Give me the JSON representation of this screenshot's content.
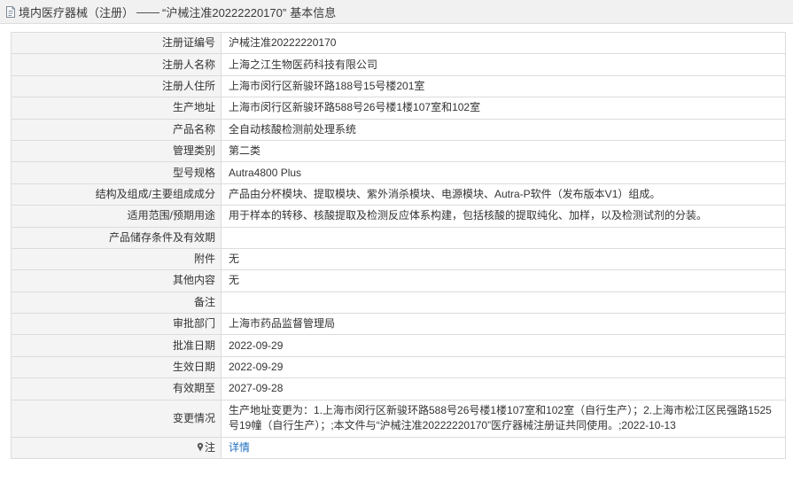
{
  "header": {
    "category": "境内医疗器械（注册）",
    "separator": "——",
    "reg_quoted": "“沪械注准20222220170”",
    "suffix": "基本信息"
  },
  "rows": [
    {
      "label": "注册证编号",
      "value": "沪械注准20222220170"
    },
    {
      "label": "注册人名称",
      "value": "上海之江生物医药科技有限公司"
    },
    {
      "label": "注册人住所",
      "value": "上海市闵行区新骏环路188号15号楼201室"
    },
    {
      "label": "生产地址",
      "value": "上海市闵行区新骏环路588号26号楼1楼107室和102室"
    },
    {
      "label": "产品名称",
      "value": "全自动核酸检测前处理系统"
    },
    {
      "label": "管理类别",
      "value": "第二类"
    },
    {
      "label": "型号规格",
      "value": "Autra4800 Plus"
    },
    {
      "label": "结构及组成/主要组成成分",
      "value": "产品由分杯模块、提取模块、紫外消杀模块、电源模块、Autra-P软件（发布版本V1）组成。"
    },
    {
      "label": "适用范围/预期用途",
      "value": "用于样本的转移、核酸提取及检测反应体系构建，包括核酸的提取纯化、加样，以及检测试剂的分装。"
    },
    {
      "label": "产品储存条件及有效期",
      "value": ""
    },
    {
      "label": "附件",
      "value": "无"
    },
    {
      "label": "其他内容",
      "value": "无"
    },
    {
      "label": "备注",
      "value": ""
    },
    {
      "label": "审批部门",
      "value": "上海市药品监督管理局"
    },
    {
      "label": "批准日期",
      "value": "2022-09-29"
    },
    {
      "label": "生效日期",
      "value": "2022-09-29"
    },
    {
      "label": "有效期至",
      "value": "2027-09-28"
    },
    {
      "label": "变更情况",
      "value": "生产地址变更为：1.上海市闵行区新骏环路588号26号楼1楼107室和102室（自行生产）；2.上海市松江区民强路1525号19幢（自行生产）；;本文件与“沪械注准20222220170”医疗器械注册证共同使用。;2022-10-13"
    }
  ],
  "note_row": {
    "label": "注",
    "link": "详情"
  },
  "icons": {
    "header": "document-icon",
    "note": "pin-icon"
  },
  "colors": {
    "link": "#1f6fc0",
    "label_bg": "#f4f4f4",
    "border": "#dcdcdc"
  }
}
